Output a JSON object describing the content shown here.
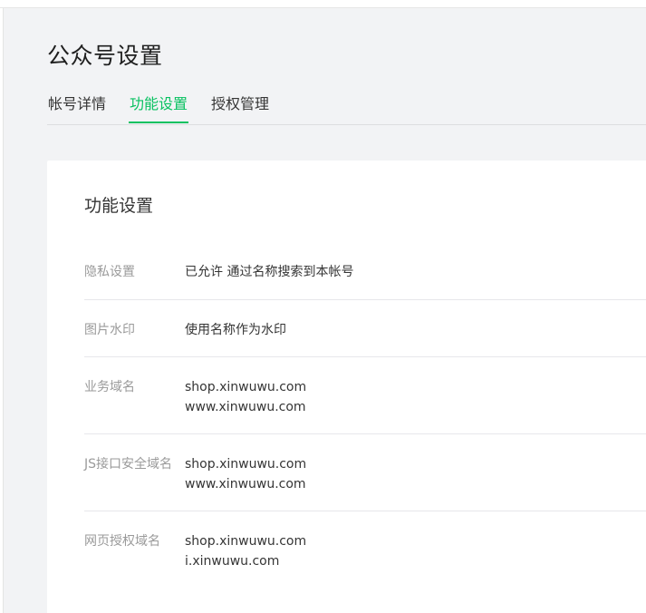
{
  "page": {
    "title": "公众号设置"
  },
  "tabs": [
    {
      "label": "帐号详情",
      "active": false
    },
    {
      "label": "功能设置",
      "active": true
    },
    {
      "label": "授权管理",
      "active": false
    }
  ],
  "colors": {
    "accent": "#07c160",
    "background": "#f2f3f5",
    "label": "#9a9a9a",
    "text": "#353535"
  },
  "section": {
    "title": "功能设置",
    "rows": [
      {
        "label": "隐私设置",
        "values": [
          "已允许 通过名称搜索到本帐号"
        ]
      },
      {
        "label": "图片水印",
        "values": [
          "使用名称作为水印"
        ]
      },
      {
        "label": "业务域名",
        "values": [
          "shop.xinwuwu.com",
          "www.xinwuwu.com"
        ]
      },
      {
        "label": "JS接口安全域名",
        "values": [
          "shop.xinwuwu.com",
          "www.xinwuwu.com"
        ]
      },
      {
        "label": "网页授权域名",
        "values": [
          "shop.xinwuwu.com",
          "i.xinwuwu.com"
        ]
      }
    ]
  }
}
